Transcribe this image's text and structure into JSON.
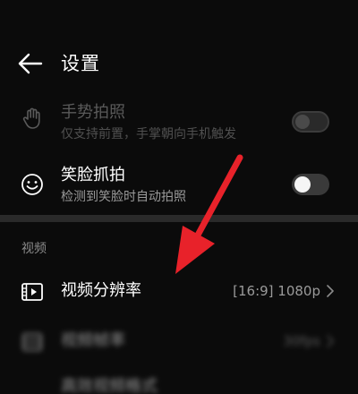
{
  "header": {
    "title": "设置",
    "back_icon": "arrow-left-icon"
  },
  "settings": {
    "gesture_photo": {
      "title": "手势拍照",
      "subtitle": "仅支持前置，手掌朝向手机触发",
      "icon": "hand-icon",
      "enabled": false,
      "available": false
    },
    "smile_capture": {
      "title": "笑脸抓拍",
      "subtitle": "检测到笑脸时自动拍照",
      "icon": "smile-icon",
      "enabled": false,
      "available": true
    }
  },
  "video_section": {
    "label": "视频",
    "resolution": {
      "title": "视频分辨率",
      "value": "[16:9] 1080p",
      "icon": "video-resolution-icon"
    },
    "frame_rate": {
      "title": "视频帧率",
      "value": "30fps",
      "icon": "frame-rate-icon"
    },
    "hdr_format": {
      "title": "高效视频格式"
    }
  },
  "overlay": {
    "annotation_arrow_color": "#e8222a"
  },
  "colors": {
    "background": "#0b0b0b",
    "text_primary": "#ffffff",
    "text_secondary": "#9a9a9a",
    "toggle_off": "#3a3a3a"
  }
}
